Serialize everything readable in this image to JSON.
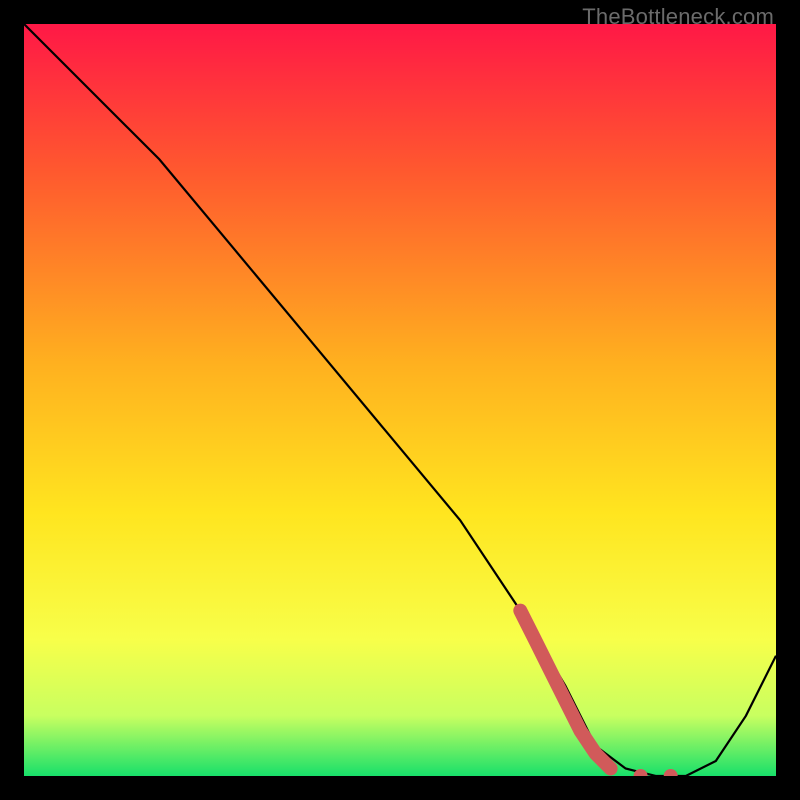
{
  "watermark": "TheBottleneck.com",
  "colors": {
    "gradient_top": "#ff1846",
    "gradient_mid1": "#ff6a2a",
    "gradient_mid2": "#ffd21f",
    "gradient_mid3": "#fff53a",
    "gradient_bottom": "#18e06a",
    "curve": "#000000",
    "dots": "#d15a5a",
    "frame": "#000000"
  },
  "chart_data": {
    "type": "line",
    "title": "",
    "xlabel": "",
    "ylabel": "",
    "xlim": [
      0,
      100
    ],
    "ylim": [
      0,
      100
    ],
    "series": [
      {
        "name": "curve",
        "x": [
          0,
          18,
          28,
          38,
          48,
          58,
          66,
          72,
          76,
          80,
          84,
          88,
          92,
          96,
          100
        ],
        "y": [
          100,
          82,
          70,
          58,
          46,
          34,
          22,
          12,
          4,
          1,
          0,
          0,
          2,
          8,
          16
        ]
      }
    ],
    "highlight": {
      "name": "highlight-dots",
      "x": [
        66,
        68,
        70,
        72,
        74,
        76,
        78,
        82,
        86
      ],
      "y": [
        22,
        18,
        14,
        10,
        6,
        3,
        1,
        0,
        0
      ]
    }
  }
}
